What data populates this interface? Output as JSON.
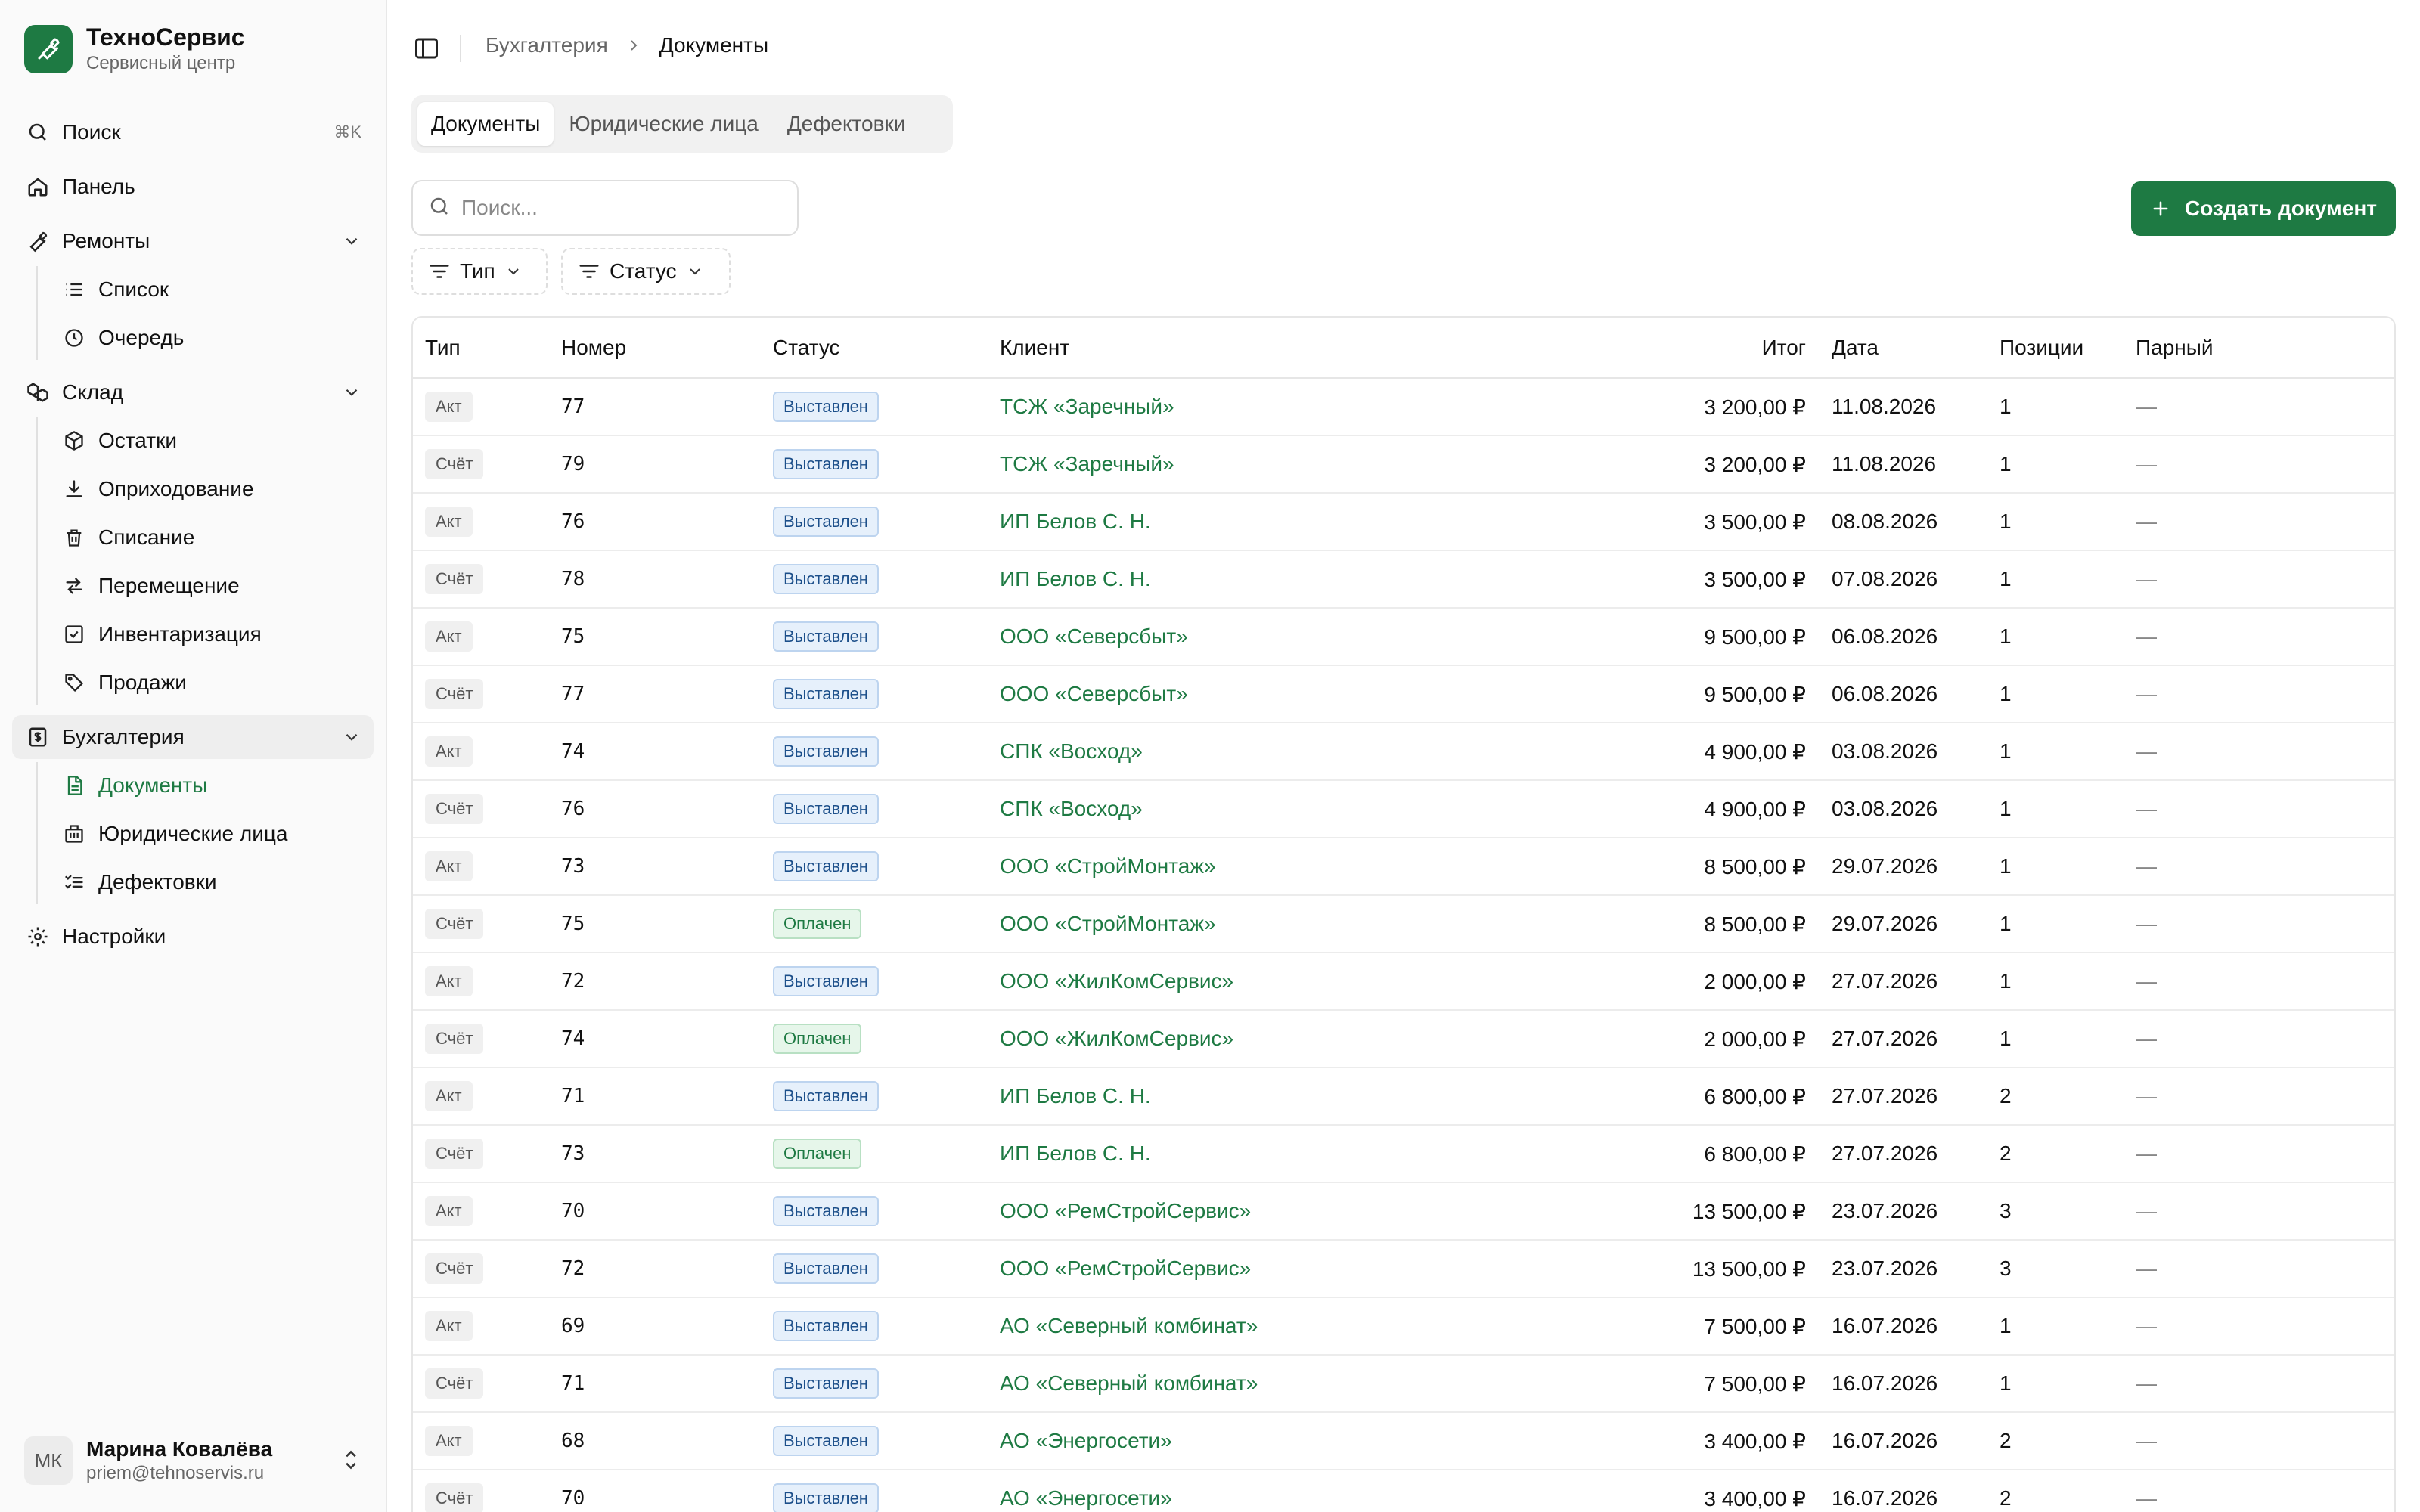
{
  "brand": {
    "title": "ТехноСервис",
    "subtitle": "Сервисный центр"
  },
  "nav": {
    "search": {
      "label": "Поиск",
      "shortcut": "⌘K"
    },
    "dashboard": "Панель",
    "repairs": {
      "label": "Ремонты",
      "items": [
        "Список",
        "Очередь"
      ]
    },
    "warehouse": {
      "label": "Склад",
      "items": [
        "Остатки",
        "Оприходование",
        "Списание",
        "Перемещение",
        "Инвентаризация",
        "Продажи"
      ]
    },
    "accounting": {
      "label": "Бухгалтерия",
      "items": [
        "Документы",
        "Юридические лица",
        "Дефектовки"
      ]
    },
    "settings": "Настройки"
  },
  "user": {
    "initials": "МК",
    "name": "Марина Ковалёва",
    "email": "priem@tehnoservis.ru"
  },
  "breadcrumb": {
    "parent": "Бухгалтерия",
    "current": "Документы"
  },
  "tabs": [
    "Документы",
    "Юридические лица",
    "Дефектовки"
  ],
  "search": {
    "placeholder": "Поиск..."
  },
  "create_button": "Создать документ",
  "filters": {
    "type": "Тип",
    "status": "Статус"
  },
  "table": {
    "headers": [
      "Тип",
      "Номер",
      "Статус",
      "Клиент",
      "Итог",
      "Дата",
      "Позиции",
      "Парный"
    ],
    "rows": [
      {
        "type": "Акт",
        "number": "77",
        "status": "Выставлен",
        "client": "ТСЖ «Заречный»",
        "total": "3 200,00 ₽",
        "date": "11.08.2026",
        "items": "1",
        "pair": "—"
      },
      {
        "type": "Счёт",
        "number": "79",
        "status": "Выставлен",
        "client": "ТСЖ «Заречный»",
        "total": "3 200,00 ₽",
        "date": "11.08.2026",
        "items": "1",
        "pair": "—"
      },
      {
        "type": "Акт",
        "number": "76",
        "status": "Выставлен",
        "client": "ИП Белов С. Н.",
        "total": "3 500,00 ₽",
        "date": "08.08.2026",
        "items": "1",
        "pair": "—"
      },
      {
        "type": "Счёт",
        "number": "78",
        "status": "Выставлен",
        "client": "ИП Белов С. Н.",
        "total": "3 500,00 ₽",
        "date": "07.08.2026",
        "items": "1",
        "pair": "—"
      },
      {
        "type": "Акт",
        "number": "75",
        "status": "Выставлен",
        "client": "ООО «Северсбыт»",
        "total": "9 500,00 ₽",
        "date": "06.08.2026",
        "items": "1",
        "pair": "—"
      },
      {
        "type": "Счёт",
        "number": "77",
        "status": "Выставлен",
        "client": "ООО «Северсбыт»",
        "total": "9 500,00 ₽",
        "date": "06.08.2026",
        "items": "1",
        "pair": "—"
      },
      {
        "type": "Акт",
        "number": "74",
        "status": "Выставлен",
        "client": "СПК «Восход»",
        "total": "4 900,00 ₽",
        "date": "03.08.2026",
        "items": "1",
        "pair": "—"
      },
      {
        "type": "Счёт",
        "number": "76",
        "status": "Выставлен",
        "client": "СПК «Восход»",
        "total": "4 900,00 ₽",
        "date": "03.08.2026",
        "items": "1",
        "pair": "—"
      },
      {
        "type": "Акт",
        "number": "73",
        "status": "Выставлен",
        "client": "ООО «СтройМонтаж»",
        "total": "8 500,00 ₽",
        "date": "29.07.2026",
        "items": "1",
        "pair": "—"
      },
      {
        "type": "Счёт",
        "number": "75",
        "status": "Оплачен",
        "client": "ООО «СтройМонтаж»",
        "total": "8 500,00 ₽",
        "date": "29.07.2026",
        "items": "1",
        "pair": "—"
      },
      {
        "type": "Акт",
        "number": "72",
        "status": "Выставлен",
        "client": "ООО «ЖилКомСервис»",
        "total": "2 000,00 ₽",
        "date": "27.07.2026",
        "items": "1",
        "pair": "—"
      },
      {
        "type": "Счёт",
        "number": "74",
        "status": "Оплачен",
        "client": "ООО «ЖилКомСервис»",
        "total": "2 000,00 ₽",
        "date": "27.07.2026",
        "items": "1",
        "pair": "—"
      },
      {
        "type": "Акт",
        "number": "71",
        "status": "Выставлен",
        "client": "ИП Белов С. Н.",
        "total": "6 800,00 ₽",
        "date": "27.07.2026",
        "items": "2",
        "pair": "—"
      },
      {
        "type": "Счёт",
        "number": "73",
        "status": "Оплачен",
        "client": "ИП Белов С. Н.",
        "total": "6 800,00 ₽",
        "date": "27.07.2026",
        "items": "2",
        "pair": "—"
      },
      {
        "type": "Акт",
        "number": "70",
        "status": "Выставлен",
        "client": "ООО «РемСтройСервис»",
        "total": "13 500,00 ₽",
        "date": "23.07.2026",
        "items": "3",
        "pair": "—"
      },
      {
        "type": "Счёт",
        "number": "72",
        "status": "Выставлен",
        "client": "ООО «РемСтройСервис»",
        "total": "13 500,00 ₽",
        "date": "23.07.2026",
        "items": "3",
        "pair": "—"
      },
      {
        "type": "Акт",
        "number": "69",
        "status": "Выставлен",
        "client": "АО «Северный комбинат»",
        "total": "7 500,00 ₽",
        "date": "16.07.2026",
        "items": "1",
        "pair": "—"
      },
      {
        "type": "Счёт",
        "number": "71",
        "status": "Выставлен",
        "client": "АО «Северный комбинат»",
        "total": "7 500,00 ₽",
        "date": "16.07.2026",
        "items": "1",
        "pair": "—"
      },
      {
        "type": "Акт",
        "number": "68",
        "status": "Выставлен",
        "client": "АО «Энергосети»",
        "total": "3 400,00 ₽",
        "date": "16.07.2026",
        "items": "2",
        "pair": "—"
      },
      {
        "type": "Счёт",
        "number": "70",
        "status": "Выставлен",
        "client": "АО «Энергосети»",
        "total": "3 400,00 ₽",
        "date": "16.07.2026",
        "items": "2",
        "pair": "—"
      }
    ]
  },
  "colors": {
    "accent": "#1e7a43",
    "status_issued": "#1c4f8a",
    "status_paid": "#1e7a43"
  }
}
